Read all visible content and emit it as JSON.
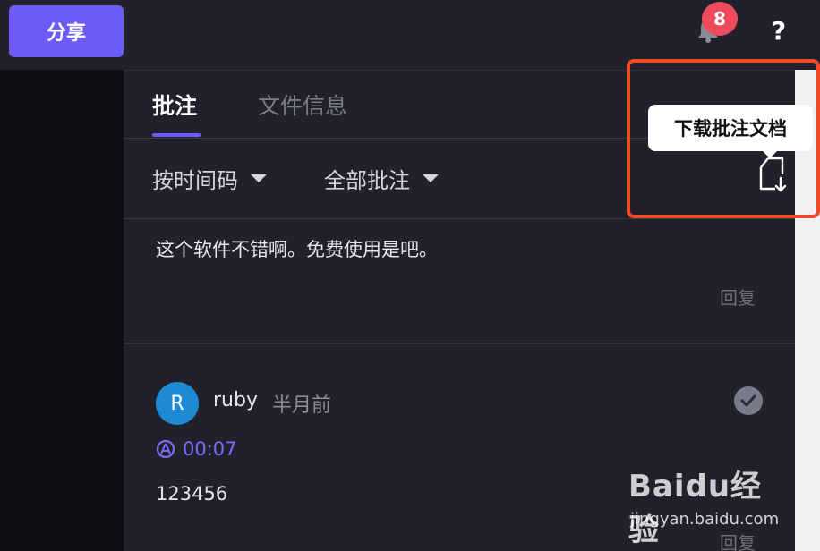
{
  "topbar": {
    "share_label": "分享",
    "notification_count": "8",
    "help_label": "?"
  },
  "tabs": [
    {
      "label": "批注"
    },
    {
      "label": "文件信息"
    }
  ],
  "filters": {
    "sort": "按时间码",
    "scope": "全部批注"
  },
  "tooltip": {
    "text": "下载批注文档"
  },
  "comments": [
    {
      "text": "这个软件不错啊。免费使用是吧。",
      "reply_label": "回复"
    },
    {
      "avatar_letter": "R",
      "username": "ruby",
      "time_ago": "半月前",
      "timecode": "00:07",
      "text": "123456",
      "reply_label": "回复"
    }
  ],
  "watermark": {
    "logo": "Baidu经验",
    "url": "jingyan.baidu.com"
  },
  "colors": {
    "accent": "#6c5cf5",
    "badge": "#ef4a5c",
    "highlight": "#f34a23",
    "avatar": "#1e8ad3"
  }
}
